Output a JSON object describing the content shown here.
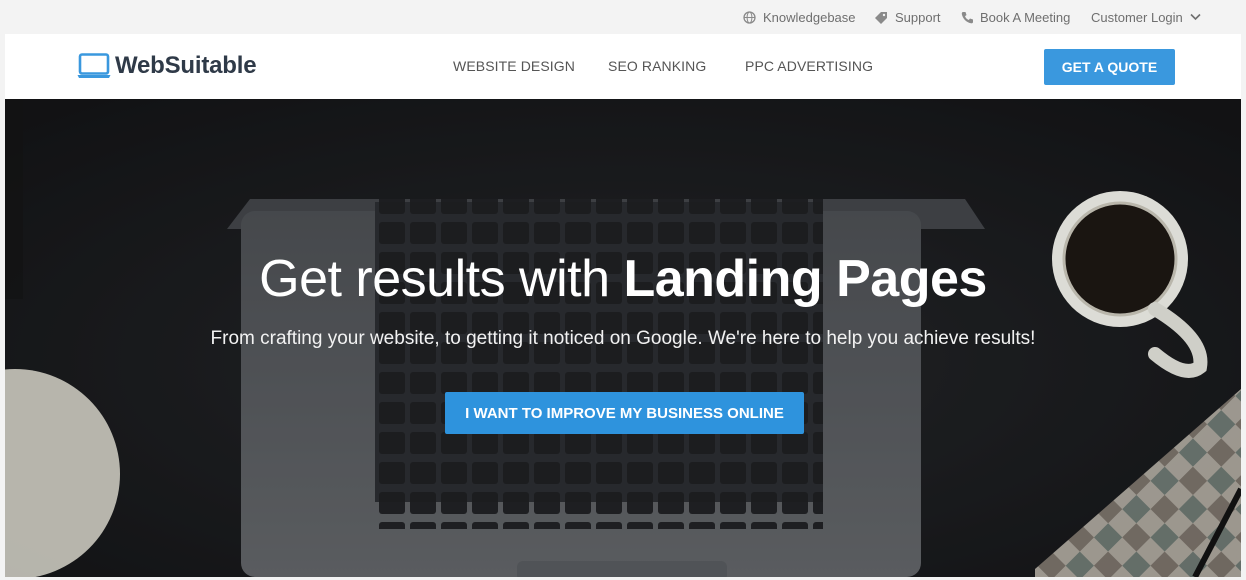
{
  "utility_bar": {
    "knowledgebase": "Knowledgebase",
    "support": "Support",
    "book_meeting": "Book A Meeting",
    "customer_login": "Customer Login"
  },
  "header": {
    "brand": "WebSuitable",
    "nav": [
      "WEBSITE DESIGN",
      "SEO RANKING",
      "PPC ADVERTISING"
    ],
    "quote_button": "GET A QUOTE"
  },
  "hero": {
    "title_light": "Get results with ",
    "title_bold": "Landing Pages",
    "subtitle": "From crafting your website, to getting it noticed on Google. We're here to help you achieve results!",
    "cta": "I WANT TO IMPROVE MY BUSINESS ONLINE"
  },
  "colors": {
    "accent": "#3a98de",
    "brand_text": "#2f3a48",
    "hero_bg": "#27292c"
  },
  "icons": {
    "knowledgebase": "globe-icon",
    "support": "tag-icon",
    "book_meeting": "phone-icon",
    "login_dropdown": "chevron-down-icon",
    "logo": "laptop-icon"
  }
}
